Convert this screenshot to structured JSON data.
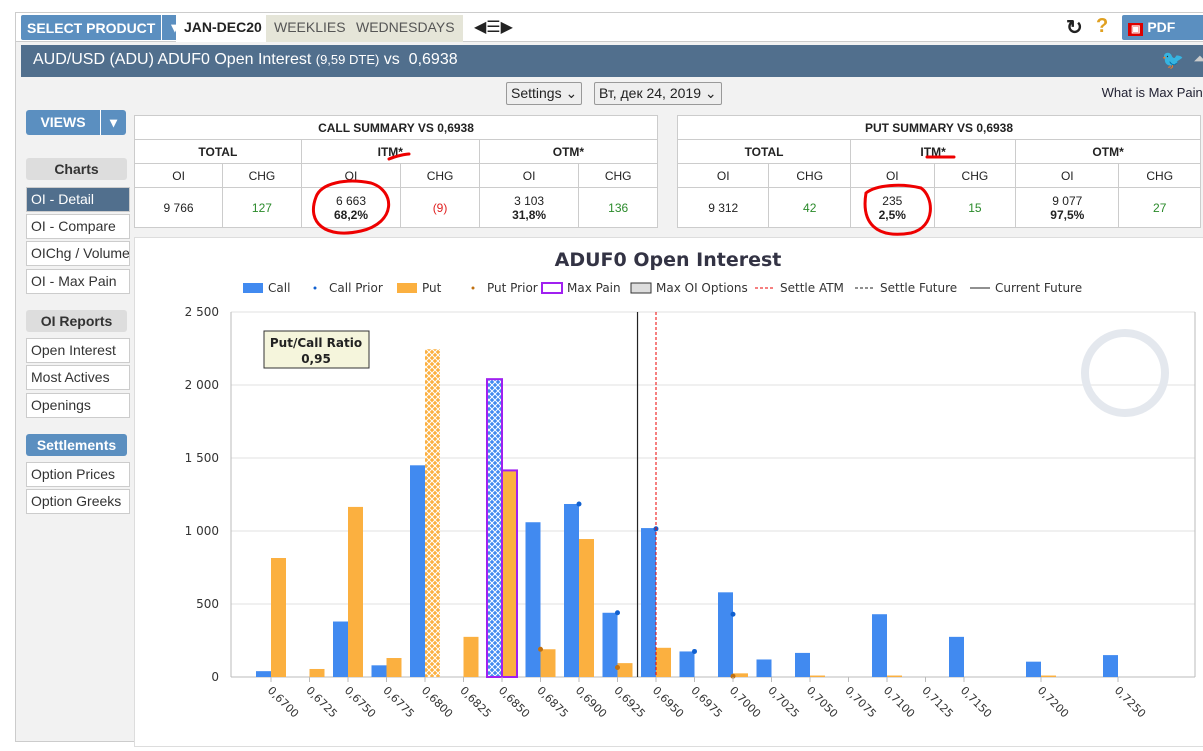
{
  "topbar": {
    "select_product": "SELECT PRODUCT",
    "tabs": [
      "JAN-DEC20",
      "WEEKLIES",
      "WEDNESDAYS"
    ],
    "pdf": "PDF"
  },
  "title": {
    "main": "AUD/USD (ADU) ADUF0 Open Interest",
    "dte": "(9,59 DTE)",
    "vs": "vs",
    "price": "0,6938"
  },
  "controls": {
    "settings": "Settings",
    "date": "Вт, дек 24, 2019",
    "help_link": "What is Max Pain?"
  },
  "sidebar": {
    "views": "VIEWS",
    "charts_header": "Charts",
    "charts": [
      "OI - Detail",
      "OI - Compare",
      "OIChg / Volume",
      "OI - Max Pain"
    ],
    "reports_header": "OI Reports",
    "reports": [
      "Open Interest",
      "Most Actives",
      "Openings"
    ],
    "settlements_header": "Settlements",
    "settlements": [
      "Option Prices",
      "Option Greeks"
    ]
  },
  "call_summary": {
    "title": "CALL SUMMARY VS 0,6938",
    "groups": [
      "TOTAL",
      "ITM*",
      "OTM*"
    ],
    "cols": [
      "OI",
      "CHG",
      "OI",
      "CHG",
      "OI",
      "CHG"
    ],
    "total_oi": "9 766",
    "total_chg": "127",
    "itm_oi": "6 663",
    "itm_pct": "68,2%",
    "itm_chg": "(9)",
    "otm_oi": "3 103",
    "otm_pct": "31,8%",
    "otm_chg": "136"
  },
  "put_summary": {
    "title": "PUT SUMMARY VS 0,6938",
    "groups": [
      "TOTAL",
      "ITM*",
      "OTM*"
    ],
    "cols": [
      "OI",
      "CHG",
      "OI",
      "CHG",
      "OI",
      "CHG"
    ],
    "total_oi": "9 312",
    "total_chg": "42",
    "itm_oi": "235",
    "itm_pct": "2,5%",
    "itm_chg": "15",
    "otm_oi": "9 077",
    "otm_pct": "97,5%",
    "otm_chg": "27"
  },
  "chart_data": {
    "type": "bar",
    "title": "ADUF0 Open Interest",
    "legend": [
      "Call",
      "Call Prior",
      "Put",
      "Put Prior",
      "Max Pain",
      "Max OI Options",
      "Settle ATM",
      "Settle Future",
      "Current Future"
    ],
    "legend_placement": "top-center",
    "ratio_label": "Put/Call Ratio",
    "ratio_value": "0,95",
    "ylim": [
      0,
      2500
    ],
    "yticks": [
      0,
      500,
      1000,
      1500,
      2000,
      2500
    ],
    "ytick_labels": [
      "0",
      "500",
      "1 000",
      "1 500",
      "2 000",
      "2 500"
    ],
    "xlim": [
      0.6675,
      0.7275
    ],
    "strikes": [
      0.67,
      0.6725,
      0.675,
      0.6775,
      0.68,
      0.6825,
      0.685,
      0.6875,
      0.69,
      0.6925,
      0.695,
      0.6975,
      0.7,
      0.7025,
      0.705,
      0.7075,
      0.71,
      0.7125,
      0.715,
      0.72,
      0.725
    ],
    "strike_labels": [
      "0,6700",
      "0,6725",
      "0,6750",
      "0,6775",
      "0,6800",
      "0,6825",
      "0,6850",
      "0,6875",
      "0,6900",
      "0,6925",
      "0,6950",
      "0,6975",
      "0,7000",
      "0,7025",
      "0,7050",
      "0,7075",
      "0,7100",
      "0,7125",
      "0,7150",
      "0,7200",
      "0,7250"
    ],
    "series": [
      {
        "name": "Call",
        "color": "#418af0",
        "values": [
          40,
          0,
          380,
          80,
          1450,
          0,
          2040,
          1060,
          1185,
          440,
          1020,
          175,
          580,
          120,
          165,
          0,
          430,
          0,
          275,
          105,
          150
        ]
      },
      {
        "name": "Put",
        "color": "#fbb040",
        "values": [
          815,
          55,
          1165,
          130,
          2245,
          275,
          1415,
          190,
          945,
          95,
          200,
          0,
          25,
          0,
          10,
          0,
          10,
          0,
          0,
          10,
          0
        ]
      },
      {
        "name": "Call Prior",
        "color": "#1060d0",
        "values": [
          null,
          null,
          null,
          null,
          null,
          null,
          null,
          null,
          1185,
          440,
          1015,
          175,
          430,
          null,
          null,
          null,
          null,
          null,
          null,
          null,
          null
        ]
      },
      {
        "name": "Put Prior",
        "color": "#c07010",
        "values": [
          null,
          null,
          null,
          null,
          null,
          null,
          null,
          190,
          null,
          65,
          null,
          null,
          5,
          null,
          null,
          null,
          null,
          null,
          null,
          null,
          null
        ]
      }
    ],
    "max_pain_strike": 0.685,
    "max_oi_call_strike": 0.685,
    "max_oi_put_strike": 0.68,
    "settle_atm": 0.695,
    "current_future": 0.6938
  }
}
